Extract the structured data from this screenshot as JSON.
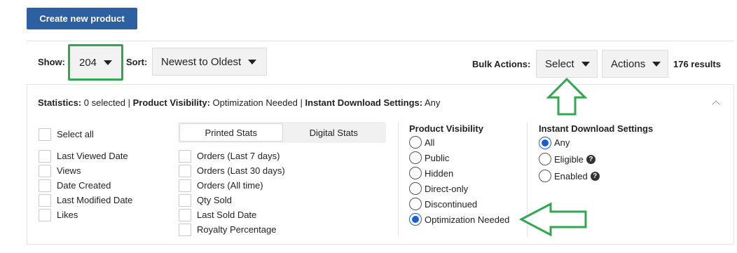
{
  "header": {
    "create_button": "Create new product"
  },
  "toolbar": {
    "show_label": "Show:",
    "show_value": "204",
    "sort_label": "Sort:",
    "sort_value": "Newest to Oldest",
    "bulk_label": "Bulk Actions:",
    "select_value": "Select",
    "actions_value": "Actions",
    "results": "176 results"
  },
  "stats": {
    "label": "Statistics:",
    "selected": " 0 selected | ",
    "visibility_label": "Product Visibility:",
    "visibility_value": " Optimization Needed | ",
    "download_label": "Instant Download Settings:",
    "download_value": " Any"
  },
  "columns": {
    "select_all": "Select all",
    "left": [
      "Last Viewed Date",
      "Views",
      "Date Created",
      "Last Modified Date",
      "Likes"
    ],
    "tabs": [
      "Printed Stats",
      "Digital Stats"
    ],
    "middle": [
      "Orders (Last 7 days)",
      "Orders (Last 30 days)",
      "Orders (All time)",
      "Qty Sold",
      "Last Sold Date",
      "Royalty Percentage"
    ]
  },
  "visibility": {
    "title": "Product Visibility",
    "options": [
      "All",
      "Public",
      "Hidden",
      "Direct-only",
      "Discontinued",
      "Optimization Needed"
    ],
    "selected": "Optimization Needed"
  },
  "download": {
    "title": "Instant Download Settings",
    "options": [
      "Any",
      "Eligible",
      "Enabled"
    ],
    "selected": "Any"
  },
  "colors": {
    "primary": "#2d5fa3",
    "highlight": "#2fa84f",
    "radio": "#1a5fd0"
  },
  "icons": [
    "caret-down-icon",
    "chevron-up-icon",
    "help-icon",
    "arrow-up-icon",
    "arrow-left-icon"
  ]
}
